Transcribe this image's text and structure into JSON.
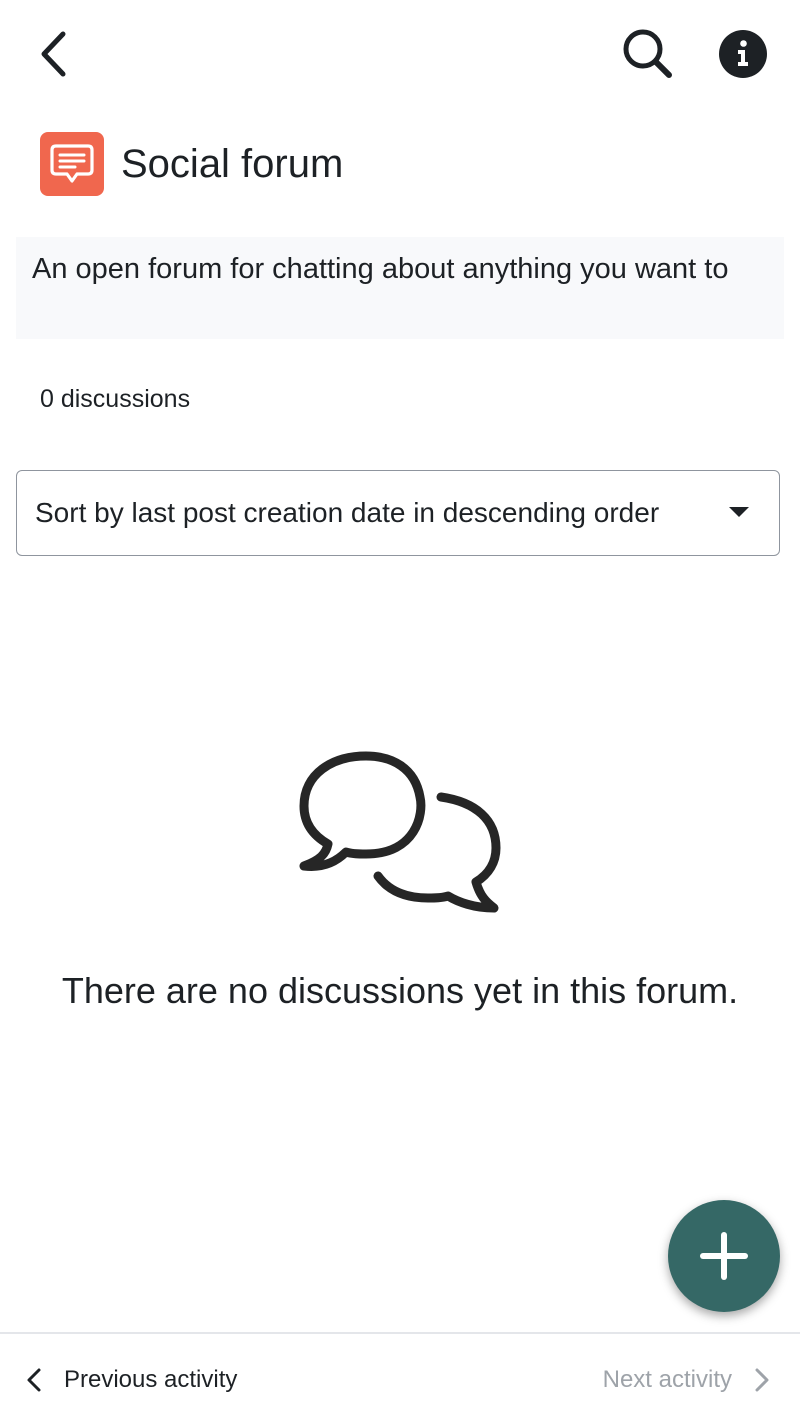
{
  "header": {
    "back_icon": "chevron-left-icon",
    "search_icon": "search-icon",
    "info_icon": "info-icon"
  },
  "forum": {
    "icon": "forum-chat-icon",
    "title": "Social forum",
    "description": "An open forum for chatting about anything you want to",
    "discussion_count": "0 discussions"
  },
  "sort": {
    "selected": "Sort by last post creation date in descending order"
  },
  "empty_state": {
    "icon": "comments-icon",
    "message": "There are no discussions yet in this forum."
  },
  "fab": {
    "icon": "plus-icon"
  },
  "footer": {
    "previous_label": "Previous activity",
    "next_label": "Next activity"
  },
  "colors": {
    "forum_icon_bg": "#f0674e",
    "fab_bg": "#356866",
    "description_bg": "#f8f9fb",
    "disabled_text": "#9ea3a9"
  }
}
